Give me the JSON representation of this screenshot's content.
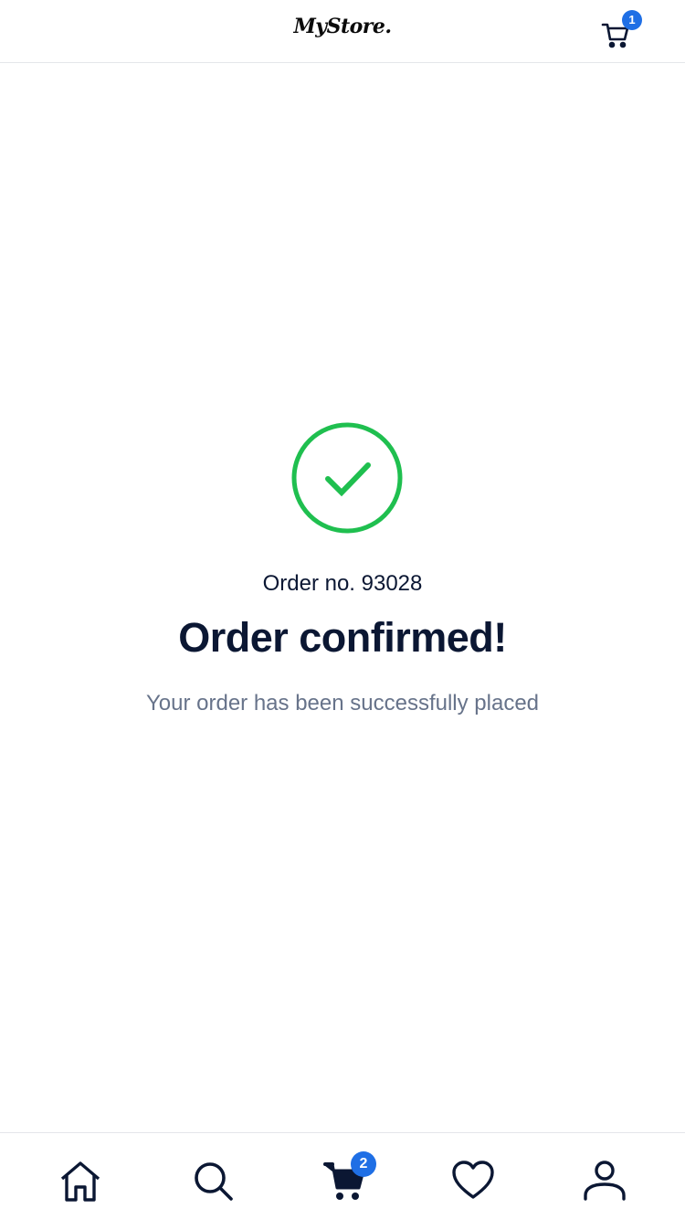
{
  "header": {
    "logo_text": "MyStore.",
    "cart_badge": "1"
  },
  "confirmation": {
    "order_number": "Order no. 93028",
    "title": "Order confirmed!",
    "message": "Your order has been successfully placed",
    "accent_color": "#1fbf4f"
  },
  "bottom_nav": {
    "items": [
      {
        "icon": "home-icon"
      },
      {
        "icon": "search-icon"
      },
      {
        "icon": "cart-icon",
        "badge": "2"
      },
      {
        "icon": "heart-icon"
      },
      {
        "icon": "user-icon"
      }
    ],
    "badge_color": "#1f6fe5"
  }
}
